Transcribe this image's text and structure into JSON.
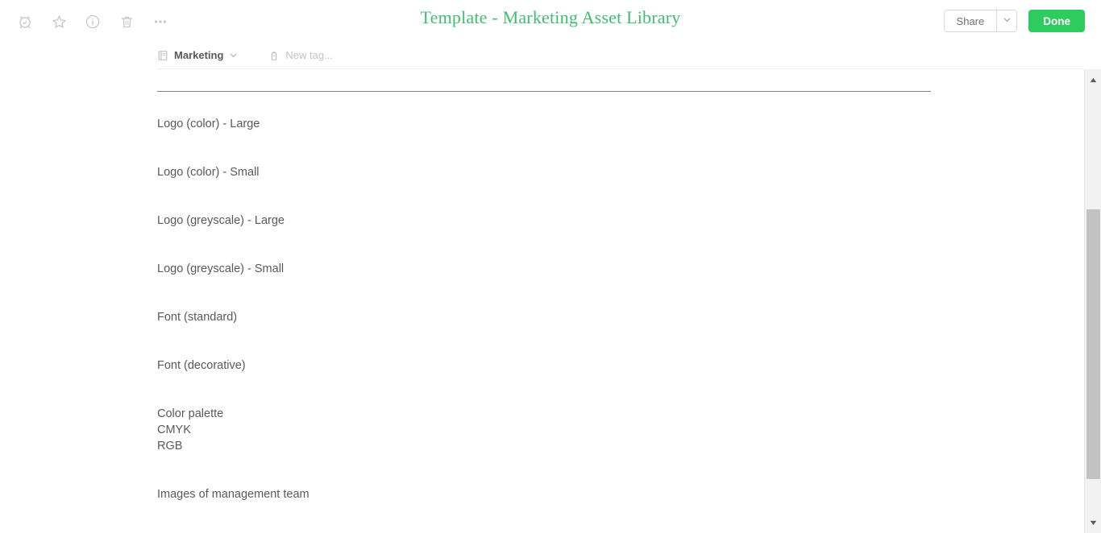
{
  "window": {
    "title": "Template - Marketing Asset Library"
  },
  "toolbar": {
    "icons": [
      {
        "name": "reminder-alarm-icon",
        "label": "Reminder"
      },
      {
        "name": "star-icon",
        "label": "Shortcut"
      },
      {
        "name": "info-icon",
        "label": "Note info"
      },
      {
        "name": "trash-icon",
        "label": "Delete note"
      },
      {
        "name": "more-options-icon",
        "label": "More"
      }
    ],
    "share_label": "Share",
    "share_caret_icon": "chevron-down-icon",
    "done_label": "Done",
    "done_color": "#2ecc5f"
  },
  "meta": {
    "notebook_icon": "notebook-icon",
    "notebook_name": "Marketing",
    "notebook_caret_icon": "chevron-down-icon",
    "tag_icon": "tag-icon",
    "new_tag_label": "New tag..."
  },
  "note": {
    "title_color": "#3fbf6e",
    "lines": [
      {
        "text": "Logo (color) - Large",
        "spacing": "first"
      },
      {
        "text": "Logo (color) - Small",
        "spacing": "gap-lg"
      },
      {
        "text": "Logo (greyscale) - Large",
        "spacing": "gap-lg"
      },
      {
        "text": "Logo (greyscale) - Small",
        "spacing": "gap-lg"
      },
      {
        "text": "Font (standard)",
        "spacing": "gap-lg"
      },
      {
        "text": "Font (decorative)",
        "spacing": "gap-lg"
      },
      {
        "text": "Color palette",
        "spacing": "gap-lg"
      },
      {
        "text": "CMYK",
        "spacing": "gap-none"
      },
      {
        "text": "RGB",
        "spacing": "gap-none"
      },
      {
        "text": "Images of management team",
        "spacing": "gap-lg"
      }
    ]
  },
  "scrollbar": {
    "up_arrow_icon": "scroll-up-arrow-icon",
    "down_arrow_icon": "scroll-down-arrow-icon",
    "thumb_name": "scrollbar-thumb"
  }
}
